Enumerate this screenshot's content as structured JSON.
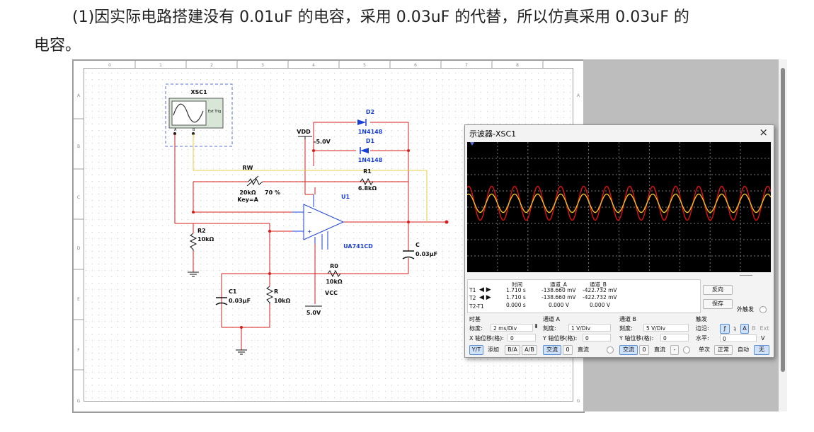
{
  "document": {
    "line1": "(1)因实际电路搭建没有 0.01uF 的电容，采用 0.03uF 的代替，所以仿真采用 0.03uF 的",
    "line2": "电容。"
  },
  "schematic": {
    "col_labels": [
      "0",
      "1",
      "2",
      "3",
      "4",
      "5",
      "6",
      "7",
      "8"
    ],
    "row_labels": [
      "A",
      "B",
      "C",
      "D",
      "E",
      "F",
      "G"
    ],
    "xsc": {
      "name": "XSC1",
      "ext": "Ext Trig",
      "a": "A",
      "b": "B"
    },
    "vdd": {
      "name": "VDD",
      "value": "-5.0V"
    },
    "vcc": {
      "name": "VCC",
      "value": "5.0V"
    },
    "d2": {
      "name": "D2",
      "part": "1N4148"
    },
    "d1": {
      "name": "D1",
      "part": "1N4148"
    },
    "rw": {
      "name": "RW",
      "value": "20kΩ",
      "pct": "70 %",
      "key": "Key=A"
    },
    "r1": {
      "name": "R1",
      "value": "6.8kΩ"
    },
    "u1": {
      "name": "U1",
      "part": "UA741CD"
    },
    "r2": {
      "name": "R2",
      "value": "10kΩ"
    },
    "c": {
      "name": "C",
      "value": "0.03µF"
    },
    "r0": {
      "name": "R0",
      "value": "10kΩ"
    },
    "c1": {
      "name": "C1",
      "value": "0.03µF"
    },
    "r": {
      "name": "R",
      "value": "10kΩ"
    }
  },
  "scope": {
    "title": "示波器-XSC1",
    "close": "×",
    "colors": {
      "a": "#e01010",
      "b": "#f0c020",
      "grid": "#7a7a7a",
      "bg": "#000000"
    },
    "readout": {
      "h_time": "时间",
      "h_a": "通道_A",
      "h_b": "通道_B",
      "t1": "T1",
      "t2": "T2",
      "t2t1": "T2-T1",
      "t1_time": "1.710 s",
      "t1_a": "-138.660 mV",
      "t1_b": "-422.732 mV",
      "t2_time": "1.710 s",
      "t2_a": "-138.660 mV",
      "t2_b": "-422.732 mV",
      "d_time": "0.000 s",
      "d_a": "0.000 V",
      "d_b": "0.000 V"
    },
    "buttons": {
      "reverse": "反向",
      "save": "保存",
      "ext_trigger": "外触发"
    },
    "timebase": {
      "title": "时基",
      "scale_label": "标度:",
      "scale": "2 ms/Div",
      "xpos_label": "X 轴位移(格):",
      "xpos": "0",
      "yt": "Y/T",
      "add": "添加",
      "ba": "B/A",
      "ab": "A/B"
    },
    "channel_a": {
      "title": "通道 A",
      "scale_label": "刻度:",
      "scale": "1 V/Div",
      "ypos_label": "Y 轴位移(格):",
      "ypos": "0",
      "ac": "交流",
      "zero": "0",
      "dc": "直流"
    },
    "channel_b": {
      "title": "通道 B",
      "scale_label": "刻度:",
      "scale": "5 V/Div",
      "ypos_label": "Y 轴位移(格):",
      "ypos": "0",
      "ac": "交流",
      "zero": "0",
      "dc": "直流",
      "minus": "-"
    },
    "trigger": {
      "title": "触发",
      "edge_label": "边沿:",
      "a": "A",
      "b": "B",
      "ext": "Ext",
      "level_label": "水平:",
      "level": "0",
      "unit": "V",
      "single": "单次",
      "normal": "正常",
      "auto": "自动",
      "none": "无"
    }
  }
}
